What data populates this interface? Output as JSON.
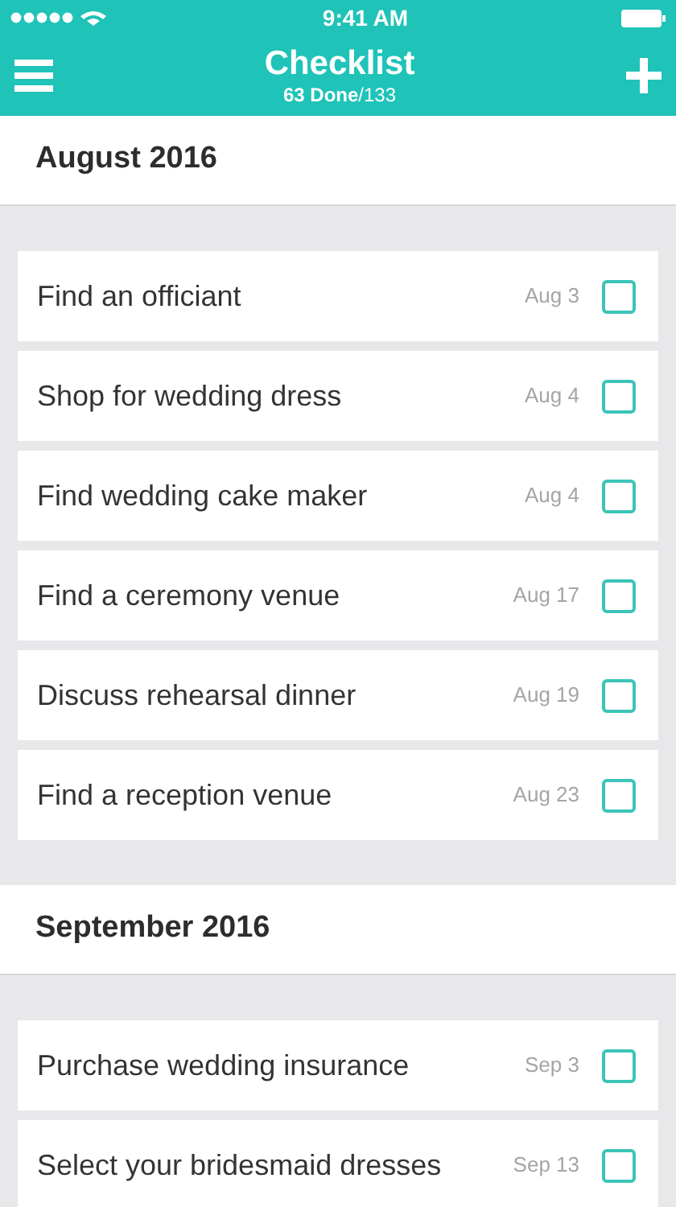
{
  "status_bar": {
    "time": "9:41 AM"
  },
  "nav": {
    "title": "Checklist",
    "subtitle": "**63 Done**/133"
  },
  "sections": [
    {
      "title": "August 2016",
      "tasks": [
        {
          "label": "Find an officiant",
          "date": "Aug 3",
          "checked": false
        },
        {
          "label": "Shop for wedding dress",
          "date": "Aug 4",
          "checked": false
        },
        {
          "label": "Find wedding cake maker",
          "date": "Aug 4",
          "checked": false
        },
        {
          "label": "Find a ceremony venue",
          "date": "Aug 17",
          "checked": false
        },
        {
          "label": "Discuss rehearsal dinner",
          "date": "Aug 19",
          "checked": false
        },
        {
          "label": "Find a reception venue",
          "date": "Aug 23",
          "checked": false
        }
      ]
    },
    {
      "title": "September 2016",
      "tasks": [
        {
          "label": "Purchase wedding insurance",
          "date": "Sep 3",
          "checked": false
        },
        {
          "label": "Select your bridesmaid dresses",
          "date": "Sep 13",
          "checked": false
        }
      ]
    }
  ]
}
